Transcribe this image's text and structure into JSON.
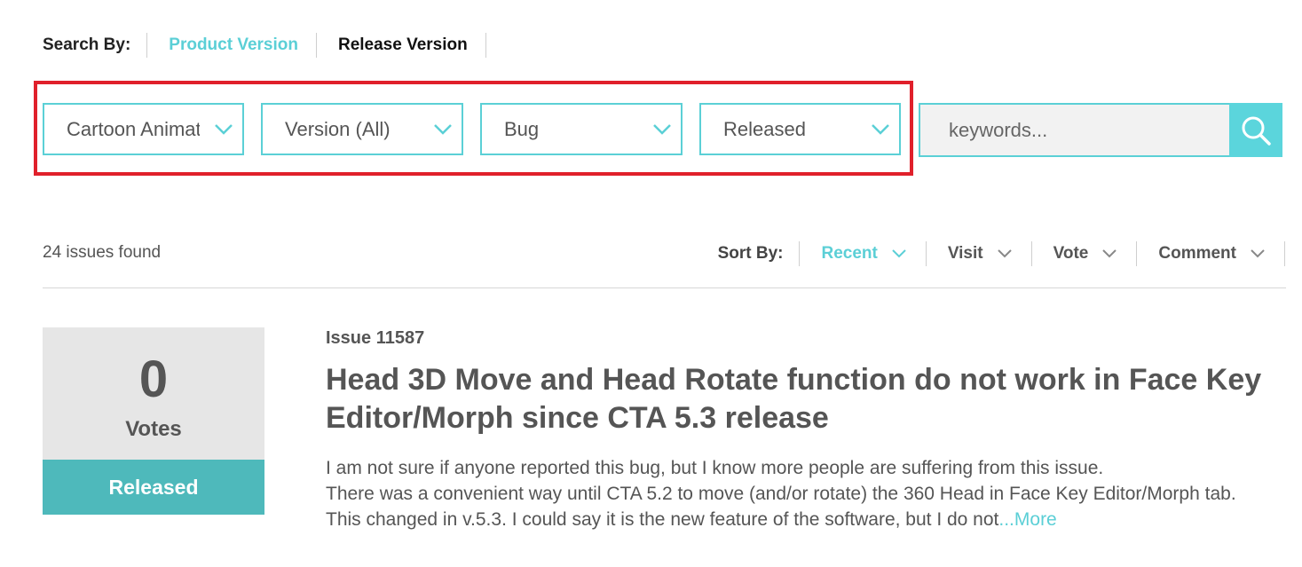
{
  "search_by": {
    "label": "Search By:",
    "options": [
      "Product Version",
      "Release Version"
    ],
    "active": "Product Version"
  },
  "filters": {
    "product": "Cartoon Animator",
    "version": "Version (All)",
    "type": "Bug",
    "status": "Released"
  },
  "search": {
    "placeholder": "keywords..."
  },
  "results": {
    "count_text": "24 issues found",
    "sort_label": "Sort By:",
    "sort_options": [
      "Recent",
      "Visit",
      "Vote",
      "Comment"
    ],
    "active_sort": "Recent"
  },
  "issue": {
    "votes": "0",
    "votes_label": "Votes",
    "status": "Released",
    "id_text": "Issue 11587",
    "title": "Head 3D Move and Head Rotate function do not work in Face Key Editor/Morph since CTA 5.3 release",
    "body_lines": [
      "I am not sure if anyone reported this bug, but I know more people are suffering from this issue.",
      "There was a convenient way until CTA 5.2 to move (and/or rotate) the 360 Head in Face Key Editor/Morph tab.",
      "This changed in v.5.3. I could say it is the new feature of the software, but I do not"
    ],
    "more_label": "...More"
  },
  "colors": {
    "accent": "#5bcfd6",
    "status_bg": "#4eb9bb",
    "highlight_frame": "#e0202b",
    "vote_bg": "#e6e6e6"
  }
}
